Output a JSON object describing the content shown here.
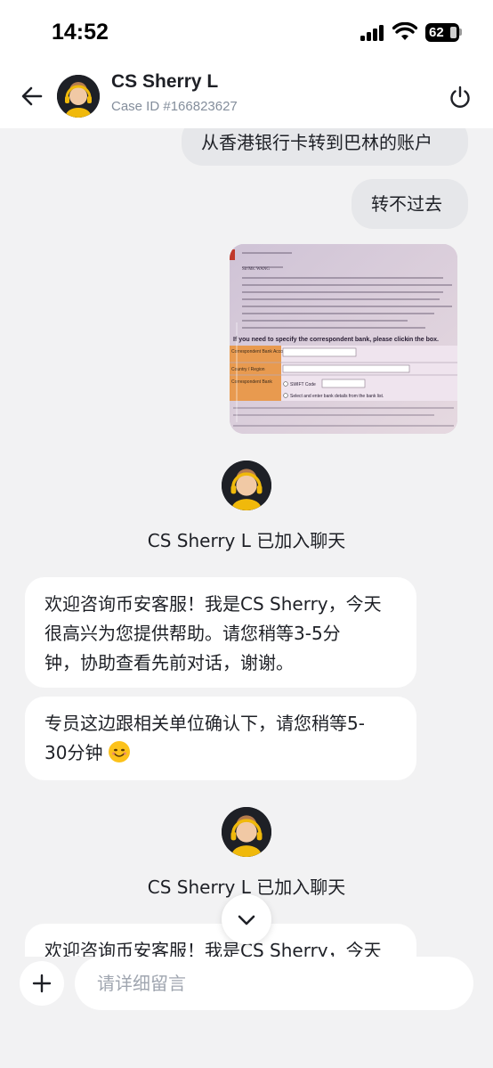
{
  "status_bar": {
    "time": "14:52",
    "battery": "62"
  },
  "header": {
    "agent_name": "CS Sherry L",
    "case_id": "Case ID #166823627"
  },
  "messages": {
    "out_1": "从香港银行卡转到巴林的账户",
    "out_2": "转不过去",
    "join_1": "CS Sherry L 已加入聊天",
    "welcome_1_line1": "欢迎咨询币安客服！我是CS Sherry，今天",
    "welcome_1_line2": "很高兴为您提供帮助。请您稍等3-5分",
    "welcome_1_line3": "钟，协助查看先前对话，谢谢。",
    "wait_line1": "专员这边跟相关单位确认下，请您稍等5-",
    "wait_line2": "30分钟",
    "join_2": "CS Sherry L 已加入聊天",
    "welcome_2_line1": "欢迎咨询币安客服！我是CS Sherry，今天"
  },
  "photo": {
    "line_a": "Sir/Ms. WANG",
    "line_b": "If you need to specify the correspondent bank, please click",
    "line_b2": "in the box.",
    "field_1": "Correspondent Bank Account Number*",
    "field_2": "Country / Region",
    "field_3": "Correspondent Bank",
    "swift": "SWIFT Code",
    "select": "Select and enter bank details from the bank list."
  },
  "input": {
    "placeholder": "请详细留言"
  },
  "colors": {
    "bubble_out": "#e6e7ea",
    "bubble_in": "#ffffff",
    "background": "#f2f2f3",
    "headset": "#f0b90b"
  }
}
